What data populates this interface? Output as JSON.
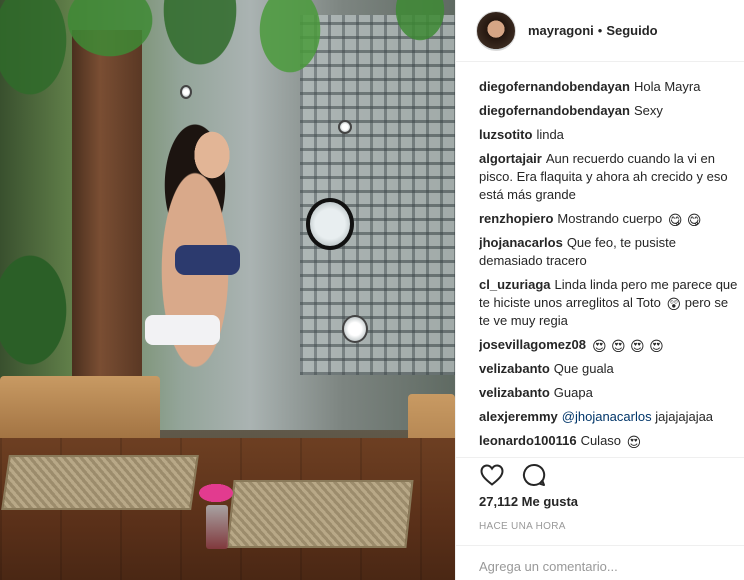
{
  "photo": {
    "description_icon": "photo"
  },
  "header": {
    "username": "mayragoni",
    "separator": "•",
    "follow_status": "Seguido"
  },
  "comments": [
    {
      "user": "diegofernandobendayan",
      "text": "Hola Mayra"
    },
    {
      "user": "diegofernandobendayan",
      "text": "Sexy"
    },
    {
      "user": "luzsotito",
      "text": "linda"
    },
    {
      "user": "algortajair",
      "text": "Aun recuerdo cuando la vi en pisco. Era flaquita y ahora ah crecido y eso está más grande"
    },
    {
      "user": "renzhopiero",
      "text": "Mostrando cuerpo",
      "emoji": "😋 😋"
    },
    {
      "user": "jhojanacarlos",
      "text": "Que feo, te pusiste demasiado tracero"
    },
    {
      "user": "cl_uzuriaga",
      "text": "Linda linda pero me parece que te hiciste unos arreglitos al Toto",
      "emoji_mid": "😲",
      "text_after": "pero se te ve muy regia"
    },
    {
      "user": "josevillagomez08",
      "text": "",
      "emoji": "😍 😍 😍 😍"
    },
    {
      "user": "velizabanto",
      "text": "Que guala"
    },
    {
      "user": "velizabanto",
      "text": "Guapa"
    },
    {
      "user": "alexjeremmy",
      "mention": "@jhojanacarlos",
      "text": "jajajajajaa"
    },
    {
      "user": "leonardo100116",
      "text": "Culaso",
      "emoji": "😍"
    }
  ],
  "actions": {
    "like_icon": "heart-icon",
    "comment_icon": "comment-icon",
    "likes_text": "27,112 Me gusta",
    "timestamp": "HACE UNA HORA"
  },
  "add_comment": {
    "placeholder": "Agrega un comentario..."
  }
}
